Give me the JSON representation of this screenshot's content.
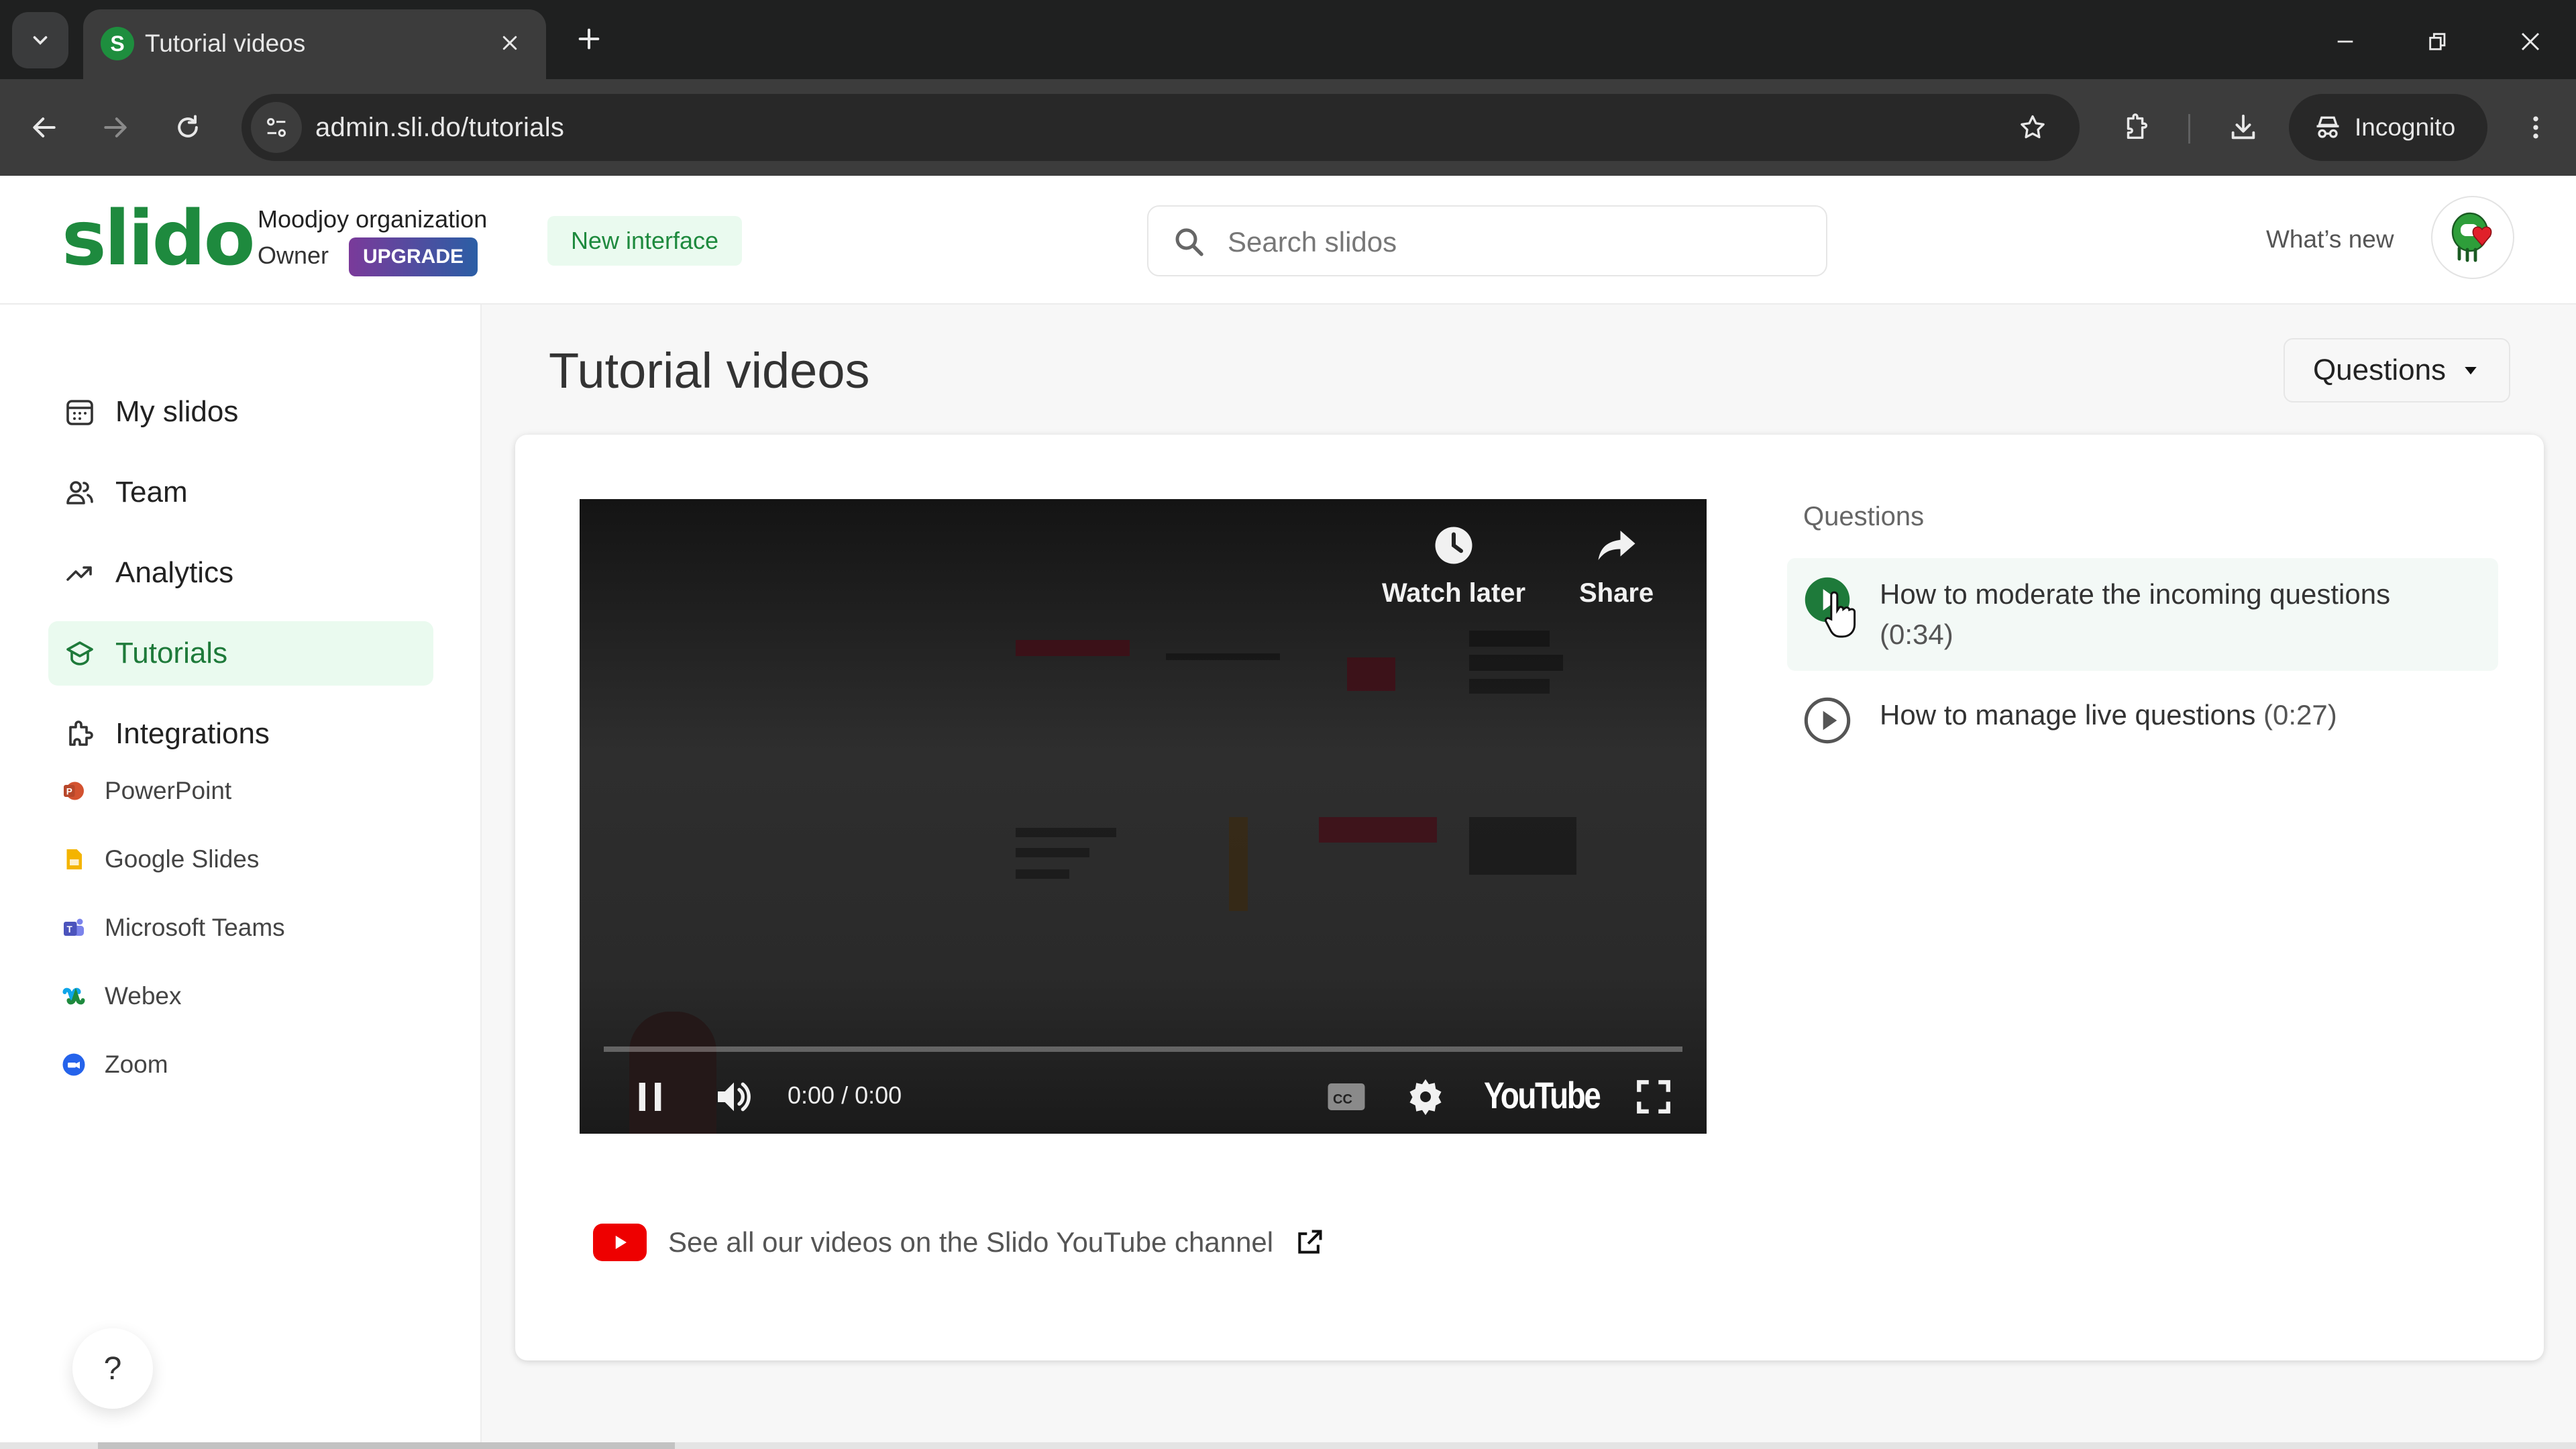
{
  "browser": {
    "tab": {
      "title": "Tutorial videos",
      "favicon_letter": "S"
    },
    "url": "admin.sli.do/tutorials",
    "incognito_label": "Incognito",
    "icons": {
      "tab_search": "chevron-down-icon",
      "tab_close": "close-icon",
      "new_tab": "plus-icon",
      "minimize": "minimize-icon",
      "restore": "restore-icon",
      "close_window": "close-icon",
      "back": "arrow-left-icon",
      "forward": "arrow-right-icon",
      "reload": "reload-icon",
      "site_info": "tune-icon",
      "bookmark": "star-icon",
      "extensions": "puzzle-icon",
      "downloads": "download-icon",
      "incognito": "incognito-icon",
      "menu": "more-vert-icon"
    }
  },
  "header": {
    "logo": "slido",
    "org_name": "Moodjoy organization",
    "role": "Owner",
    "upgrade_label": "UPGRADE",
    "new_interface_label": "New interface",
    "search_placeholder": "Search slidos",
    "search_value": "",
    "whats_new_label": "What’s new"
  },
  "sidebar": {
    "items": [
      {
        "label": "My slidos",
        "icon": "calendar-icon",
        "active": false
      },
      {
        "label": "Team",
        "icon": "users-icon",
        "active": false
      },
      {
        "label": "Analytics",
        "icon": "trending-up-icon",
        "active": false
      },
      {
        "label": "Tutorials",
        "icon": "graduation-cap-icon",
        "active": true
      },
      {
        "label": "Integrations",
        "icon": "puzzle-icon",
        "active": false
      }
    ],
    "integrations": [
      {
        "label": "PowerPoint",
        "icon": "powerpoint-icon"
      },
      {
        "label": "Google Slides",
        "icon": "google-slides-icon"
      },
      {
        "label": "Microsoft Teams",
        "icon": "microsoft-teams-icon"
      },
      {
        "label": "Webex",
        "icon": "webex-icon"
      },
      {
        "label": "Zoom",
        "icon": "zoom-icon"
      }
    ],
    "help_label": "?"
  },
  "main": {
    "title": "Tutorial videos",
    "category_dropdown": {
      "selected": "Questions"
    },
    "video": {
      "watch_later_label": "Watch later",
      "share_label": "Share",
      "time": "0:00 / 0:00",
      "progress": 0,
      "state": "playing",
      "brand": "YouTube"
    },
    "youtube_link": "See all our videos on the Slido YouTube channel",
    "section_heading": "Questions",
    "videos": [
      {
        "title": "How to moderate the incoming questions",
        "duration": "(0:34)",
        "active": true
      },
      {
        "title": "How to manage live questions",
        "duration": "(0:27)",
        "active": false
      }
    ]
  },
  "colors": {
    "brand_green": "#1e8a3e",
    "active_bg": "#eafaef",
    "upgrade_from": "#7a3a9a",
    "upgrade_to": "#2b5ea5",
    "youtube_red": "#e00000",
    "chrome_dark": "#1f2020",
    "chrome_toolbar": "#3c3c3c"
  }
}
